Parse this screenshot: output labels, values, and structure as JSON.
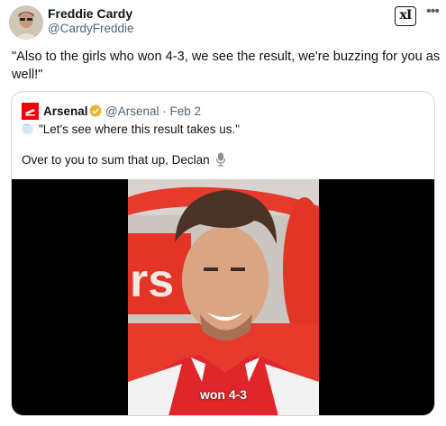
{
  "author": {
    "name": "Freddie Cardy",
    "handle": "@CardyFreddie"
  },
  "header_actions": {
    "xi_badge": "xI",
    "more_icon": "more-horizontal-icon"
  },
  "tweet_text": "\"Also to the girls who won 4-3, we see the result, we're buzzing for you as well!\"",
  "quote": {
    "name": "Arsenal",
    "handle_date": "@Arsenal · Feb 2",
    "line1": "\"Let's see where this result takes us.\"",
    "line2": "Over to you to sum that up, Declan",
    "verified_color": "#e6b52c",
    "brand_color": "#ef0107"
  },
  "video": {
    "caption": "won 4-3"
  }
}
